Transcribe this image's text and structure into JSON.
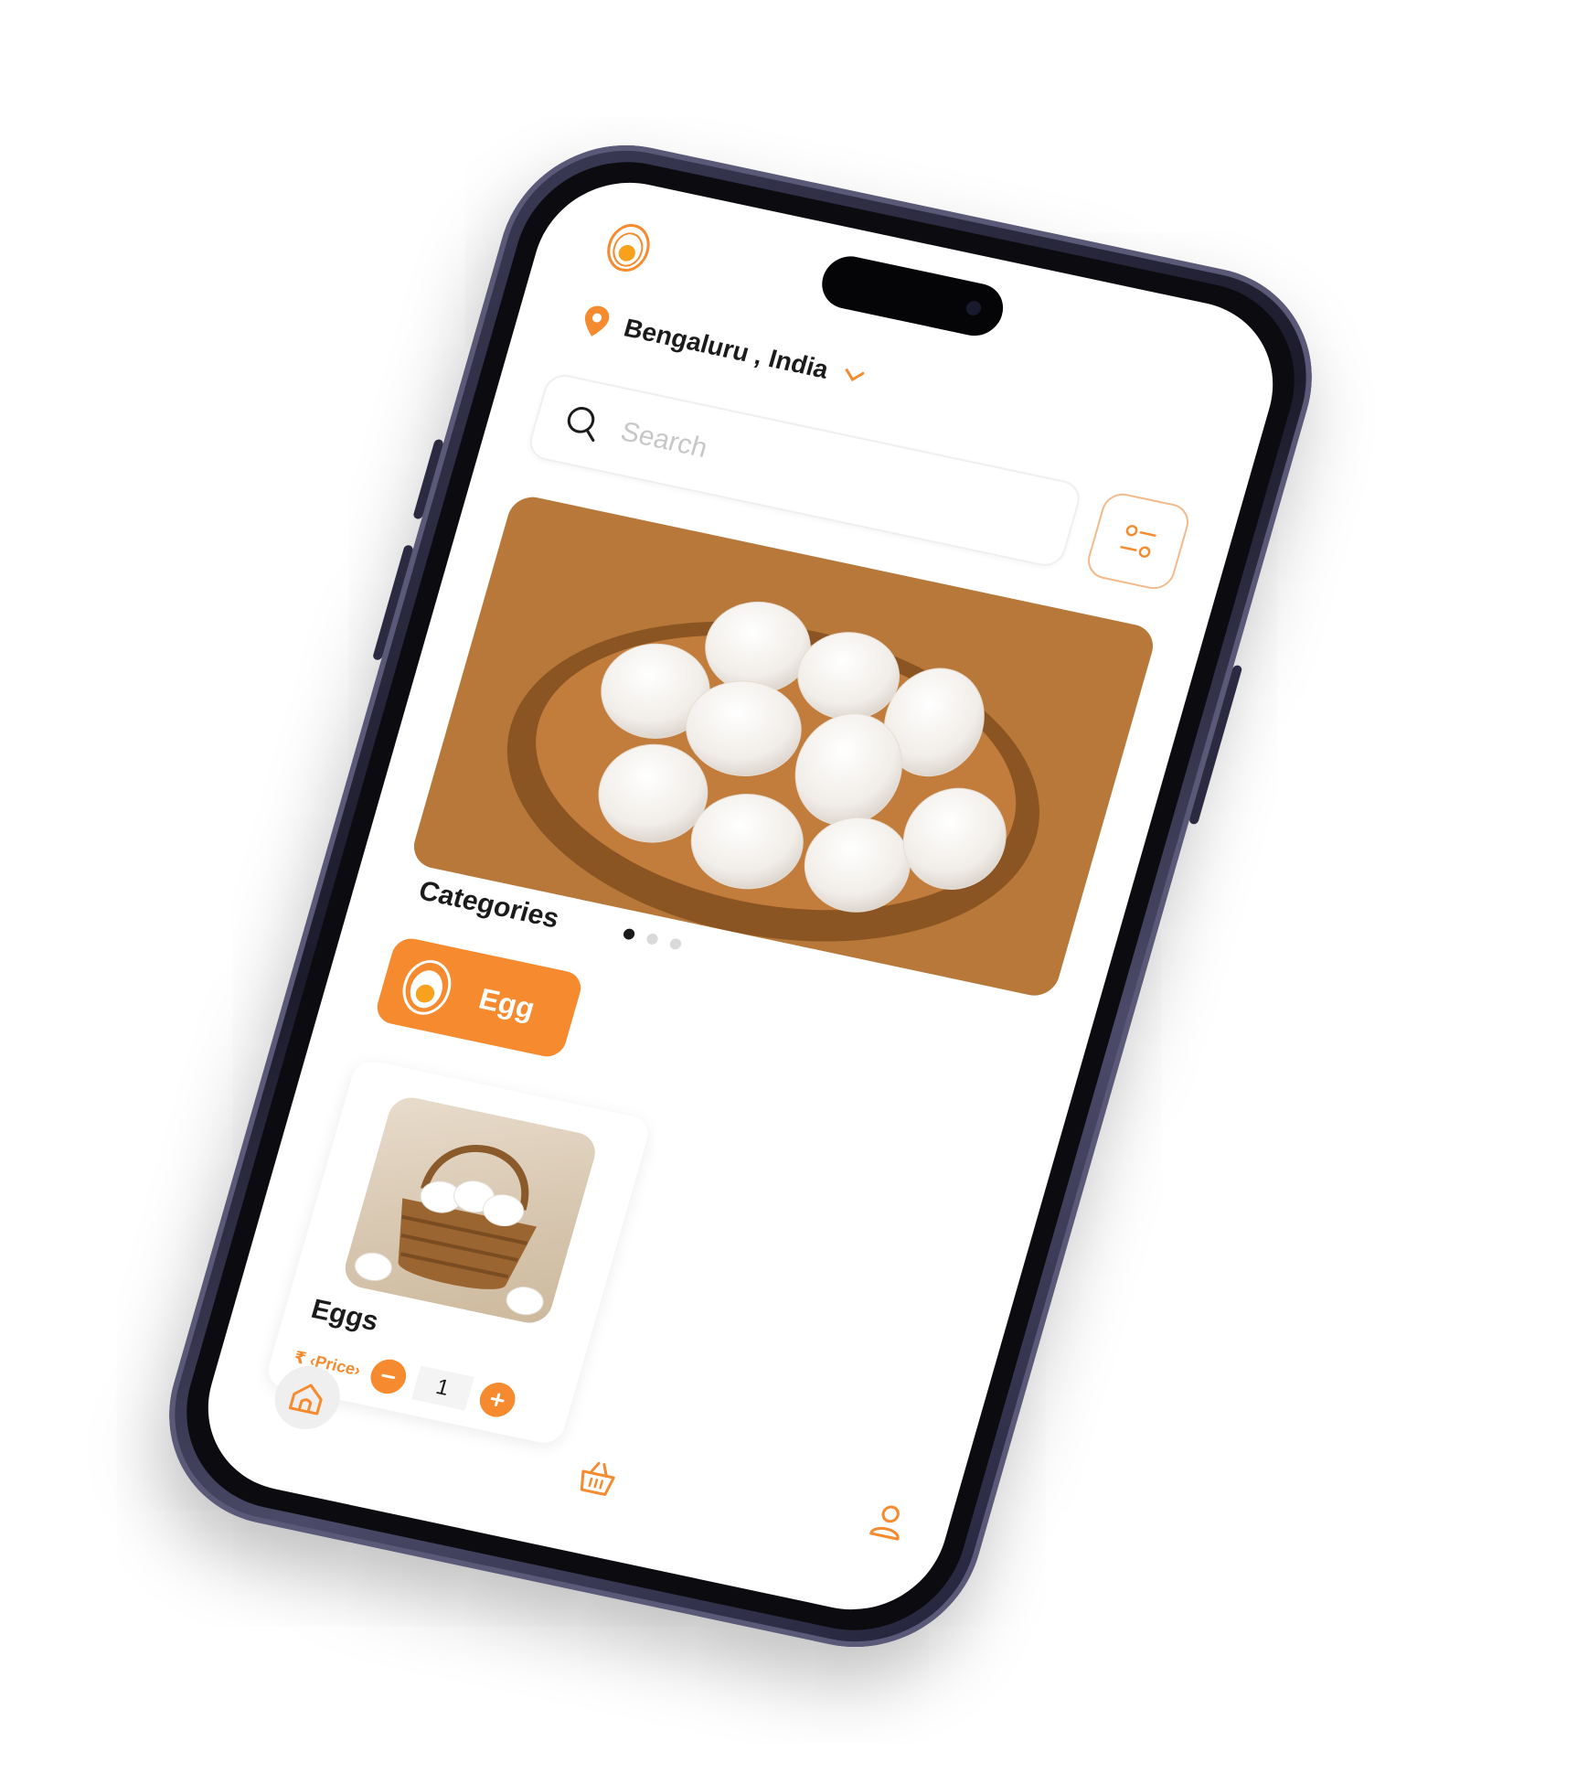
{
  "location": {
    "label": "Bengaluru , India"
  },
  "search": {
    "placeholder": "Search"
  },
  "banner": {
    "slides_total": 3,
    "active_slide": 1
  },
  "categories": {
    "title": "Categories",
    "items": [
      {
        "label": "Egg",
        "selected": true
      }
    ]
  },
  "products": [
    {
      "name": "Eggs",
      "price": "₹ ‹Price›",
      "quantity": "1"
    }
  ],
  "tabbar": {
    "items": [
      {
        "icon": "home-icon",
        "active": true
      },
      {
        "icon": "basket-icon",
        "active": false
      },
      {
        "icon": "profile-icon",
        "active": false
      }
    ]
  },
  "colors": {
    "accent": "#f58a2e",
    "text": "#1b1b1b",
    "phone_frame": "#2b2a40"
  }
}
